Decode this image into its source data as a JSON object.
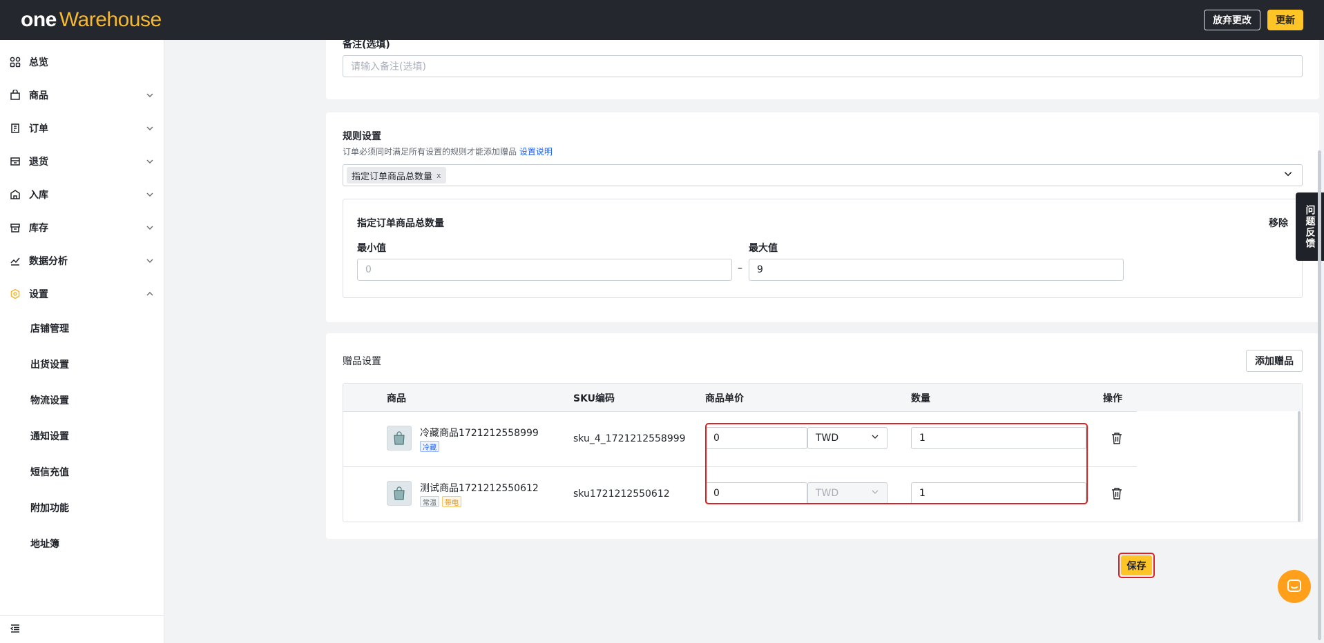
{
  "header": {
    "logo_one": "ONE",
    "logo_warehouse": "Warehouse",
    "discard_label": "放弃更改",
    "update_label": "更新"
  },
  "sidebar": {
    "items": [
      {
        "label": "总览",
        "icon": "dashboard-icon"
      },
      {
        "label": "商品",
        "icon": "product-icon"
      },
      {
        "label": "订单",
        "icon": "order-icon"
      },
      {
        "label": "退货",
        "icon": "return-icon"
      },
      {
        "label": "入库",
        "icon": "inbound-icon"
      },
      {
        "label": "库存",
        "icon": "inventory-icon"
      },
      {
        "label": "数据分析",
        "icon": "analytics-icon"
      },
      {
        "label": "设置",
        "icon": "settings-icon"
      }
    ],
    "sub_items": [
      "店铺管理",
      "出货设置",
      "物流设置",
      "通知设置",
      "短信充值",
      "附加功能",
      "地址簿"
    ]
  },
  "remark": {
    "label": "备注(选填)",
    "placeholder": "请输入备注(选填)"
  },
  "rules": {
    "title": "规则设置",
    "hint": "订单必须同时满足所有设置的规则才能添加赠品",
    "hint_link": "设置说明",
    "selected_tag": "指定订单商品总数量",
    "tag_close": "x",
    "box_title": "指定订单商品总数量",
    "remove_label": "移除",
    "min_label": "最小值",
    "min_placeholder": "0",
    "max_label": "最大值",
    "max_value": "9",
    "dash": "–"
  },
  "gifts": {
    "title": "赠品设置",
    "add_label": "添加赠品",
    "columns": {
      "product": "商品",
      "sku": "SKU编码",
      "price": "商品单价",
      "qty": "数量",
      "action": "操作"
    },
    "rows": [
      {
        "name": "冷藏商品1721212558999",
        "tags": [
          "冷藏"
        ],
        "sku": "sku_4_1721212558999",
        "price": "0",
        "currency": "TWD",
        "qty": "1"
      },
      {
        "name": "测试商品1721212550612",
        "tags": [
          "常温",
          "带电"
        ],
        "sku": "sku1721212550612",
        "price": "0",
        "currency": "TWD",
        "qty": "1"
      }
    ]
  },
  "save_label": "保存",
  "feedback_label": "问题反馈",
  "colors": {
    "brand_yellow": "#ffc425",
    "header_bg": "#24272e",
    "highlight_red": "#e02020",
    "link_blue": "#1d5ef5"
  }
}
